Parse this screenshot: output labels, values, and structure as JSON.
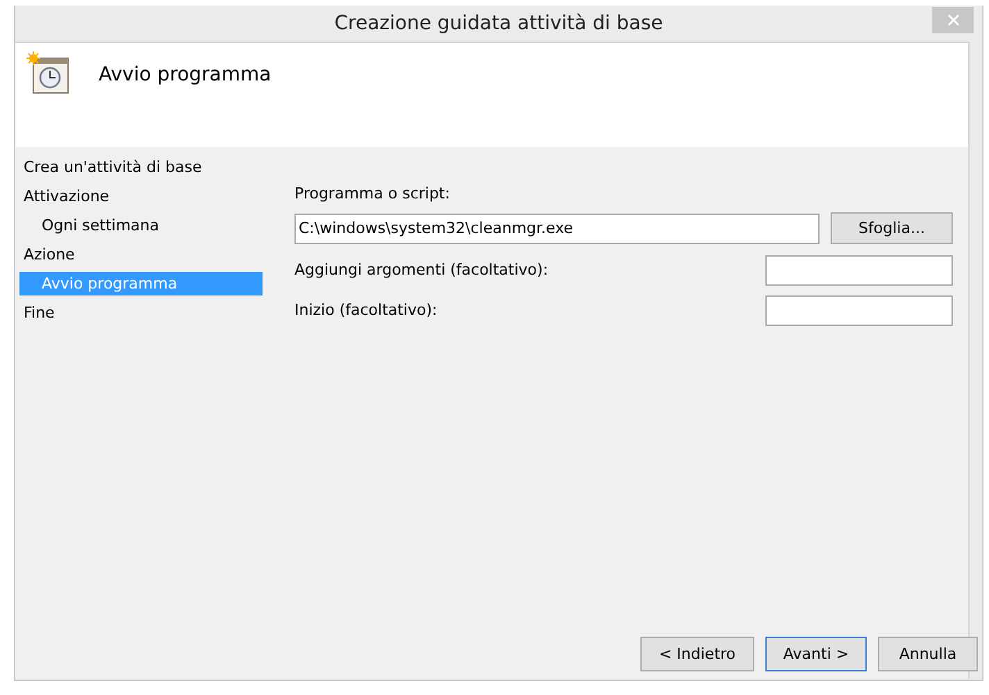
{
  "window": {
    "title": "Creazione guidata attività di base"
  },
  "header": {
    "title": "Avvio programma"
  },
  "steps": [
    {
      "label": "Crea un'attività di base",
      "selected": false
    },
    {
      "label": "Attivazione",
      "selected": false,
      "children": [
        {
          "label": "Ogni settimana",
          "selected": false
        }
      ]
    },
    {
      "label": "Azione",
      "selected": false,
      "children": [
        {
          "label": "Avvio programma",
          "selected": true
        }
      ]
    },
    {
      "label": "Fine",
      "selected": false
    }
  ],
  "form": {
    "program_label": "Programma o script:",
    "program_value": "C:\\windows\\system32\\cleanmgr.exe",
    "browse_button": "Sfoglia...",
    "arguments_label": "Aggiungi argomenti (facoltativo):",
    "start_label": "Inizio (facoltativo):"
  },
  "buttons": [
    {
      "label": "< Indietro",
      "default": false
    },
    {
      "label": "Avanti >",
      "default": true
    },
    {
      "label": "Annulla",
      "default": false
    }
  ]
}
